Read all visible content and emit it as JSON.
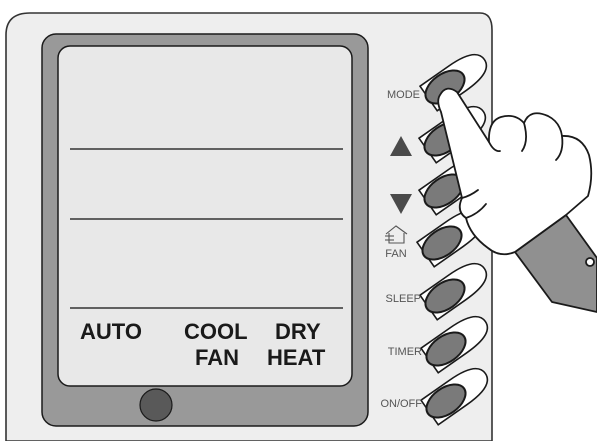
{
  "device": {
    "buttons": [
      {
        "label": "MODE",
        "icon": "none"
      },
      {
        "label": "",
        "icon": "up-triangle-icon"
      },
      {
        "label": "",
        "icon": "down-triangle-icon"
      },
      {
        "label": "FAN",
        "icon": "fan-house-icon"
      },
      {
        "label": "SLEEP",
        "icon": "none"
      },
      {
        "label": "TIMER",
        "icon": "none"
      },
      {
        "label": "ON/OFF",
        "icon": "none"
      }
    ],
    "display": {
      "mode_row1": [
        "AUTO",
        "COOL",
        "DRY"
      ],
      "mode_row2": [
        "FAN",
        "HEAT"
      ]
    },
    "pointer": "hand-pointer-icon",
    "colors": {
      "body": "#eeeeee",
      "display_frame": "#999999",
      "display_screen": "#e8e8e8",
      "button": "#7a7a7a",
      "sensor": "#595959"
    }
  }
}
